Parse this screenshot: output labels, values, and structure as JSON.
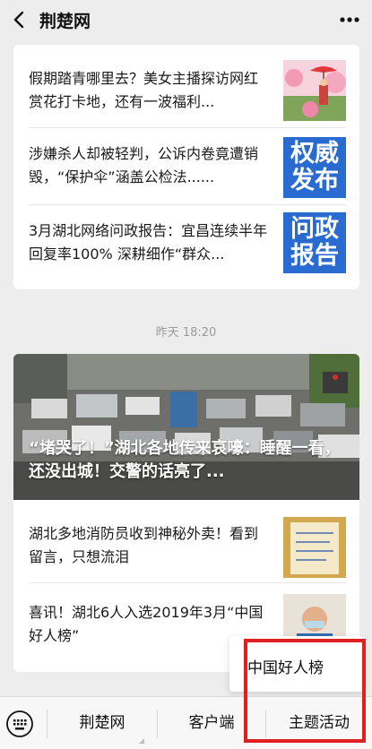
{
  "header": {
    "title": "荆楚网",
    "back_icon": "chevron-left-icon",
    "more_icon": "more-dots-icon"
  },
  "articles_top": [
    {
      "title": "假期踏青哪里去？美女主播探访网红赏花打卡地，还有一波福利...",
      "thumb_icon": "flower-photo"
    },
    {
      "title": "涉嫌杀人却被轻判，公诉内卷竟遭销毁，“保护伞”涵盖公检法......",
      "thumb_text": [
        "权威",
        "发布"
      ],
      "thumb_color": "#2a6bd1"
    },
    {
      "title": "3月湖北网络问政报告：宜昌连续半年回复率100% 深耕细作“群众...",
      "thumb_text": [
        "问政",
        "报告"
      ],
      "thumb_color": "#2a6bd1"
    }
  ],
  "timestamp": "昨天 18:20",
  "hero_article": {
    "title": "“堵哭了！”湖北各地传来哀嚎：睡醒一看，还没出城！交警的话亮了..."
  },
  "articles_bottom": [
    {
      "title": "湖北多地消防员收到神秘外卖！看到留言，只想流泪",
      "thumb_icon": "note-photo"
    },
    {
      "title": "喜讯！湖北6人入选2019年3月“中国好人榜”",
      "thumb_icon": "person-photo"
    }
  ],
  "popup_menu": {
    "items": [
      "中国好人榜"
    ]
  },
  "bottom_menu": {
    "keyboard_icon": "keyboard-icon",
    "items": [
      "荆楚网",
      "客户端",
      "主题活动"
    ]
  },
  "colors": {
    "highlight": "#e02020",
    "accent_blue": "#2a6bd1"
  }
}
